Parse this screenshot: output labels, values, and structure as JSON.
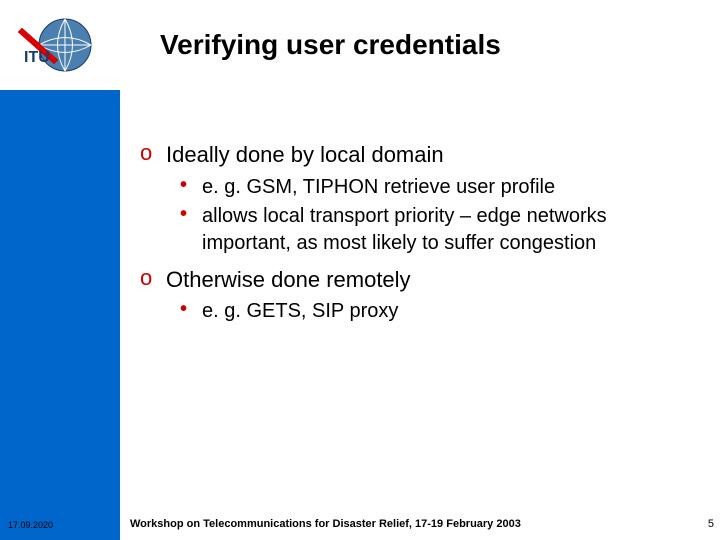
{
  "title": "Verifying user credentials",
  "bullets": [
    {
      "text": "Ideally done by local domain",
      "subs": [
        "e. g. GSM, TIPHON retrieve user profile",
        "allows local transport priority – edge networks important, as most likely to suffer congestion"
      ]
    },
    {
      "text": "Otherwise done remotely",
      "subs": [
        "e. g. GETS, SIP proxy"
      ]
    }
  ],
  "footer": {
    "date": "17.09.2020",
    "caption": "Workshop on Telecommunications for Disaster Relief, 17-19 February 2003",
    "page": "5"
  },
  "markers": {
    "o": "o",
    "dot": "•"
  }
}
